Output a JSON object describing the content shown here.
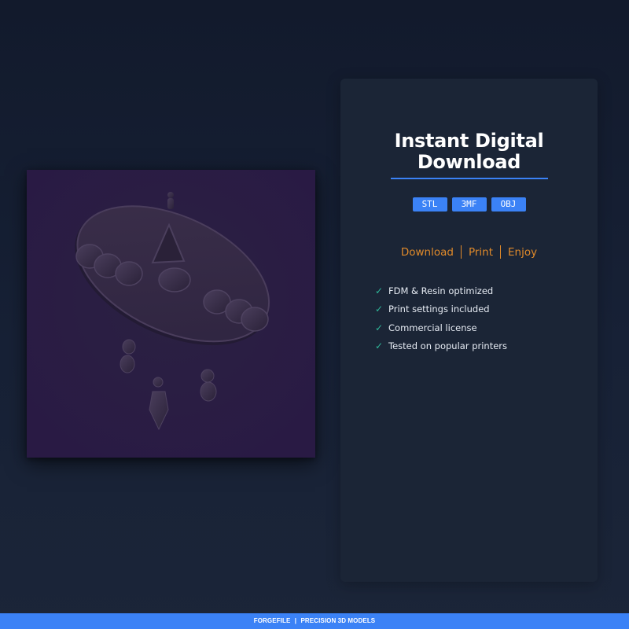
{
  "preview": {
    "image_label": "3D printable hanging moon phase ornament model"
  },
  "card": {
    "title_line1": "Instant Digital",
    "title_line2": "Download",
    "formats": [
      "STL",
      "3MF",
      "OBJ"
    ],
    "steps": [
      "Download",
      "Print",
      "Enjoy"
    ],
    "features": [
      "FDM & Resin optimized",
      "Print settings included",
      "Commercial license",
      "Tested on popular printers"
    ]
  },
  "footer": {
    "brand": "FORGEFILE",
    "separator": "|",
    "tagline": "PRECISION 3D MODELS"
  },
  "colors": {
    "accent": "#3b82f6",
    "step_text": "#e08a2a",
    "check": "#2fb89a",
    "card_bg": "#1b2536",
    "preview_bg": "#2c1f45"
  }
}
